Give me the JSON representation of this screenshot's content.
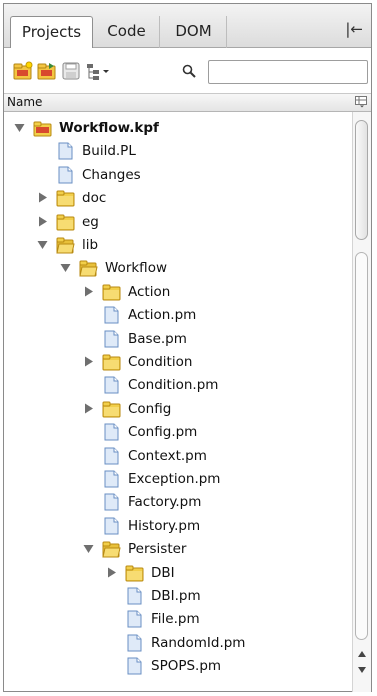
{
  "tabs": [
    {
      "label": "Projects",
      "active": true
    },
    {
      "label": "Code",
      "active": false
    },
    {
      "label": "DOM",
      "active": false
    }
  ],
  "collapse_button_glyph": "|←",
  "toolbar": {
    "icons": [
      "new-project-icon",
      "open-project-icon",
      "save-project-icon",
      "project-menu-icon"
    ],
    "search_icon": "search-icon",
    "filter_value": "",
    "filter_placeholder": ""
  },
  "header": {
    "name_label": "Name"
  },
  "colors": {
    "folder_yellow": "#f2cf4a",
    "folder_edge": "#b88a12",
    "file_blue": "#dfeaf8",
    "file_edge": "#6a8fc3",
    "project_red": "#d8492e"
  },
  "tree": [
    {
      "label": "Workflow.kpf",
      "kind": "project",
      "depth": 0,
      "state": "expanded",
      "bold": true
    },
    {
      "label": "Build.PL",
      "kind": "file",
      "depth": 1,
      "state": "none"
    },
    {
      "label": "Changes",
      "kind": "file",
      "depth": 1,
      "state": "none"
    },
    {
      "label": "doc",
      "kind": "folder",
      "depth": 1,
      "state": "collapsed"
    },
    {
      "label": "eg",
      "kind": "folder",
      "depth": 1,
      "state": "collapsed"
    },
    {
      "label": "lib",
      "kind": "folder",
      "depth": 1,
      "state": "expanded"
    },
    {
      "label": "Workflow",
      "kind": "folder",
      "depth": 2,
      "state": "expanded"
    },
    {
      "label": "Action",
      "kind": "folder",
      "depth": 3,
      "state": "collapsed"
    },
    {
      "label": "Action.pm",
      "kind": "file",
      "depth": 3,
      "state": "none"
    },
    {
      "label": "Base.pm",
      "kind": "file",
      "depth": 3,
      "state": "none"
    },
    {
      "label": "Condition",
      "kind": "folder",
      "depth": 3,
      "state": "collapsed"
    },
    {
      "label": "Condition.pm",
      "kind": "file",
      "depth": 3,
      "state": "none"
    },
    {
      "label": "Config",
      "kind": "folder",
      "depth": 3,
      "state": "collapsed"
    },
    {
      "label": "Config.pm",
      "kind": "file",
      "depth": 3,
      "state": "none"
    },
    {
      "label": "Context.pm",
      "kind": "file",
      "depth": 3,
      "state": "none"
    },
    {
      "label": "Exception.pm",
      "kind": "file",
      "depth": 3,
      "state": "none"
    },
    {
      "label": "Factory.pm",
      "kind": "file",
      "depth": 3,
      "state": "none"
    },
    {
      "label": "History.pm",
      "kind": "file",
      "depth": 3,
      "state": "none"
    },
    {
      "label": "Persister",
      "kind": "folder",
      "depth": 3,
      "state": "expanded"
    },
    {
      "label": "DBI",
      "kind": "folder",
      "depth": 4,
      "state": "collapsed"
    },
    {
      "label": "DBI.pm",
      "kind": "file",
      "depth": 4,
      "state": "none"
    },
    {
      "label": "File.pm",
      "kind": "file",
      "depth": 4,
      "state": "none"
    },
    {
      "label": "RandomId.pm",
      "kind": "file",
      "depth": 4,
      "state": "none"
    },
    {
      "label": "SPOPS.pm",
      "kind": "file",
      "depth": 4,
      "state": "none"
    }
  ]
}
